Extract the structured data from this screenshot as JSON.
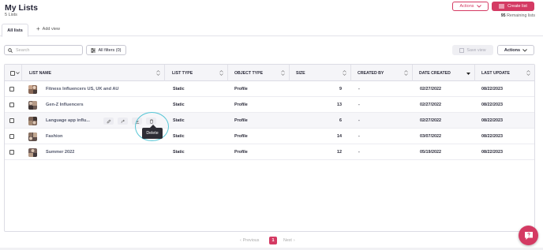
{
  "header": {
    "title": "My Lists",
    "subtitle": "5 Lists",
    "actions_label": "Actions",
    "create_label": "Create list",
    "remaining_count": "95",
    "remaining_label": "Remaining lists"
  },
  "tabs": {
    "all_lists": "All lists",
    "add_view": "Add view"
  },
  "toolbar": {
    "search_placeholder": "Search",
    "filters_label": "All filters (0)",
    "save_view_label": "Save view",
    "actions_label": "Actions"
  },
  "table": {
    "columns": [
      "LIST NAME",
      "LIST TYPE",
      "OBJECT TYPE",
      "SIZE",
      "CREATED BY",
      "DATE CREATED",
      "LAST UPDATE"
    ],
    "rows": [
      {
        "name": "Fitness Influencers US, UK and AU",
        "type": "Static",
        "object": "Profile",
        "size": "9",
        "created_by": "-",
        "date_created": "02/27/2022",
        "last_update": "08/22/2023"
      },
      {
        "name": "Gen-Z Influencers",
        "type": "Static",
        "object": "Profile",
        "size": "13",
        "created_by": "-",
        "date_created": "02/27/2022",
        "last_update": "08/22/2023"
      },
      {
        "name": "Language app influ...",
        "type": "Static",
        "object": "Profile",
        "size": "6",
        "created_by": "-",
        "date_created": "02/27/2022",
        "last_update": "08/22/2023"
      },
      {
        "name": "Fashion",
        "type": "Static",
        "object": "Profile",
        "size": "14",
        "created_by": "-",
        "date_created": "03/07/2022",
        "last_update": "08/22/2023"
      },
      {
        "name": "Summer 2022",
        "type": "Static",
        "object": "Profile",
        "size": "12",
        "created_by": "-",
        "date_created": "05/19/2022",
        "last_update": "08/22/2023"
      }
    ]
  },
  "tooltip": {
    "delete": "Delete"
  },
  "pagination": {
    "prev": "Previous",
    "current": "1",
    "next": "Next"
  },
  "colors": {
    "accent": "#d43a63",
    "highlight": "#56c6d6"
  }
}
